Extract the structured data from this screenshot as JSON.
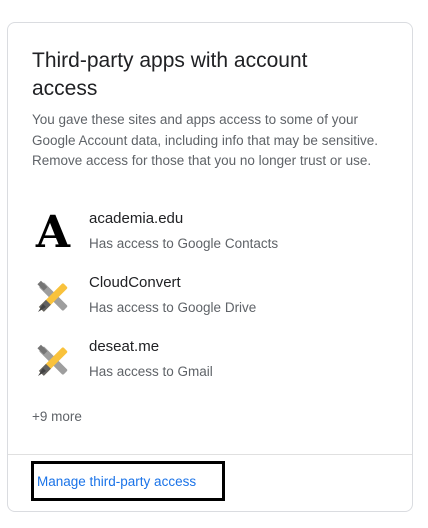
{
  "card": {
    "title": "Third-party apps with account access",
    "description": "You gave these sites and apps access to some of your Google Account data, including info that may be sensitive. Remove access for those that you no longer trust or use."
  },
  "apps": [
    {
      "name": "academia.edu",
      "access": "Has access to Google Contacts",
      "icon": "academia-logo-icon",
      "icon_text": "A"
    },
    {
      "name": "CloudConvert",
      "access": "Has access to Google Drive",
      "icon": "tools-icon"
    },
    {
      "name": "deseat.me",
      "access": "Has access to Gmail",
      "icon": "tools-icon"
    }
  ],
  "more_label": "+9 more",
  "manage_link": "Manage third-party access",
  "colors": {
    "title": "#202124",
    "secondary_text": "#5f6368",
    "link": "#1a73e8",
    "border": "#dadce0",
    "tool_yellow": "#f9c23c",
    "tool_gray": "#9e9e9e"
  }
}
